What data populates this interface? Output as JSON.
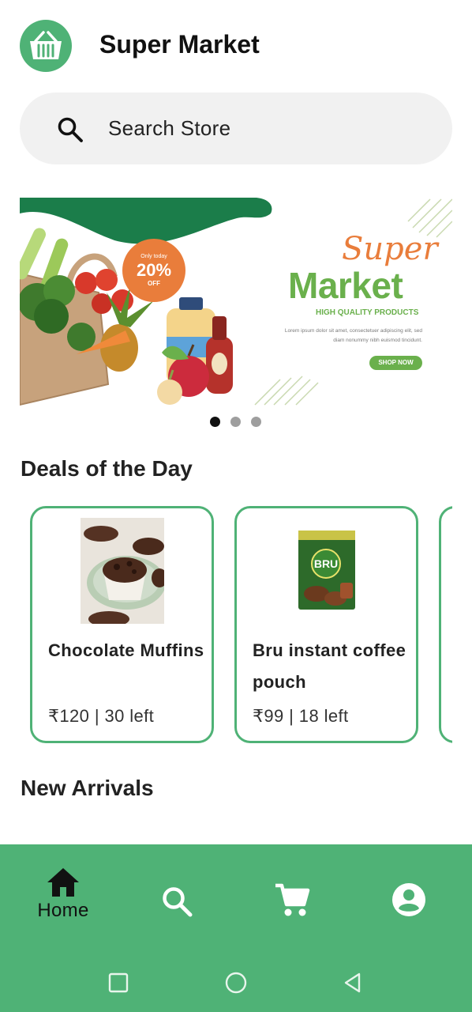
{
  "app": {
    "title": "Super Market",
    "logo_icon": "basket-icon",
    "accent": "#4fb276"
  },
  "search": {
    "placeholder": "Search Store",
    "icon": "search-icon"
  },
  "banner": {
    "promo_small": "Only today",
    "promo_percent": "20%",
    "promo_off": "OFF",
    "title_line1": "Super",
    "title_line2": "Market",
    "tagline": "HIGH QUALITY PRODUCTS",
    "body": "Lorem ipsum dolor sit amet, consectetuer adipiscing elit, sed diam nonummy nibh euismod tincidunt.",
    "cta": "SHOP NOW",
    "carousel": {
      "total_pages": 3,
      "active_page": 1
    }
  },
  "sections": {
    "deals_title": "Deals of the Day",
    "new_arrivals_title": "New Arrivals"
  },
  "deals": [
    {
      "title": "Chocolate Muffins",
      "meta": "₹120 | 30 left",
      "image": "muffin-photo"
    },
    {
      "title": "Bru instant coffee pouch",
      "meta": "₹99 | 18 left",
      "image": "coffee-pouch-photo"
    }
  ],
  "nav": {
    "items": [
      {
        "label": "Home",
        "icon": "home-icon",
        "active": true
      },
      {
        "label": "",
        "icon": "search-icon",
        "active": false
      },
      {
        "label": "",
        "icon": "cart-icon",
        "active": false
      },
      {
        "label": "",
        "icon": "account-icon",
        "active": false
      }
    ]
  },
  "system_nav": {
    "buttons": [
      "recents-icon",
      "home-circle-icon",
      "back-icon"
    ]
  }
}
